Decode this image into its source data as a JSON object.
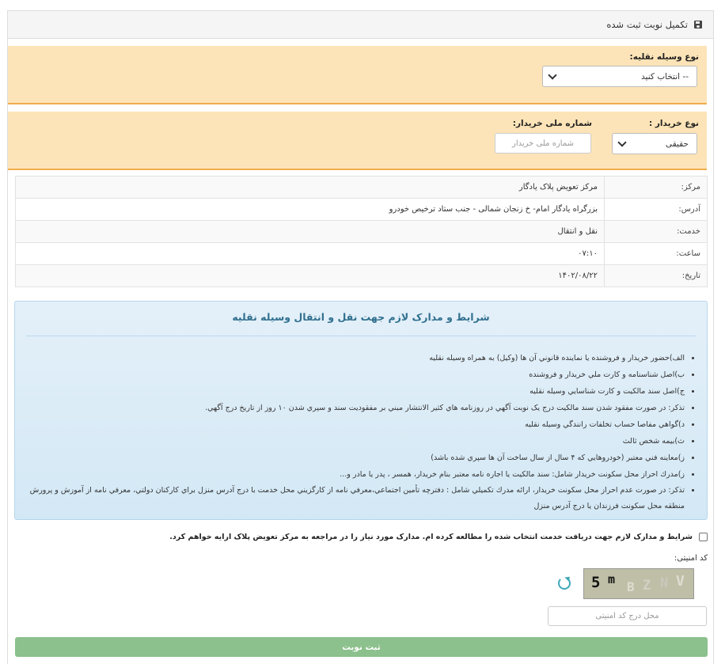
{
  "header": {
    "title": "تکمیل نوبت ثبت شده"
  },
  "vehicle": {
    "label": "نوع وسیله نقلیه:",
    "selected": "-- انتخاب کنید"
  },
  "buyer": {
    "type_label": "نوع خریدار :",
    "type_selected": "حقیقی",
    "national_id_label": "شماره ملی خریدار:",
    "national_id_placeholder": "شماره ملی خریدار",
    "national_id_value": ""
  },
  "info": {
    "rows": [
      {
        "key": "مرکز:",
        "value": "مرکز تعویض پلاک یادگار"
      },
      {
        "key": "آدرس:",
        "value": "بزرگراه یادگار امام- خ زنجان شمالی - جنب ستاد ترخیص خودرو"
      },
      {
        "key": "خدمت:",
        "value": "نقل و انتقال"
      },
      {
        "key": "ساعت:",
        "value": "۰۷:۱۰"
      },
      {
        "key": "تاریخ:",
        "value": "۱۴۰۲/۰۸/۲۲"
      }
    ]
  },
  "terms": {
    "title": "شرایط و مدارک لازم جهت نقل و انتقال وسیله نقلیه",
    "items": [
      "الف)حضور خريدار و فروشنده يا نماينده قانوني آن ها (وكيل) به همراه وسيله نقليه",
      "ب)اصل شناسنامه و كارت ملي خريدار و فروشنده",
      "ج)اصل سند مالكيت و كارت شناسايي وسيله نقليه",
      "تذكر: در صورت مفقود شدن سند مالكيت درج يک نوبت آگهي در روزنامه هاي كثير الانتشار مبني بر مفقوديت سند و سپري شدن ۱۰ روز از تاريخ درج آگهي.",
      "د)گواهي مفاصا حساب تخلفات رانندگي وسيله نقليه",
      "ث)بيمه شخص ثالث",
      "ز)معاينه فني معتبر (خودروهايي كه ۴ سال از سال ساخت آن ها سپري شده باشد)",
      "ز)مدرك احراز محل سكونت خريدار شامل: سند مالكيت يا اجاره نامه معتبر بنام خريدار، همسر ، پدر يا مادر و...",
      "تذكر: در صورت عدم احراز محل سكونت خريدار، ارائه مدرك تكميلي شامل : دفترچه تأمين اجتماعي،معرفي نامه از كارگزيني محل خدمت با درج آدرس منزل براي كاركنان دولتي، معرفي نامه از آموزش و پرورش منطقه محل سكونت فرزندان يا درج آدرس منزل"
    ]
  },
  "agreement": {
    "label": "شرایط و مدارک لازم جهت دریافت خدمت انتخاب شده را مطالعه کرده ام. مدارک مورد نیاز را در مراجعه به مرکز تعویض پلاک ارایه خواهم کرد."
  },
  "security": {
    "label": "کد امنیتی:",
    "captcha_text": "5mBZNV",
    "placeholder": "محل درج کد امنیتی"
  },
  "submit": {
    "label": "ثبت نوبت"
  },
  "colors": {
    "warning_bg": "#fde4b8",
    "warning_border": "#f0ad4e",
    "info_title": "#31708f",
    "submit_bg": "#8cc08c"
  }
}
